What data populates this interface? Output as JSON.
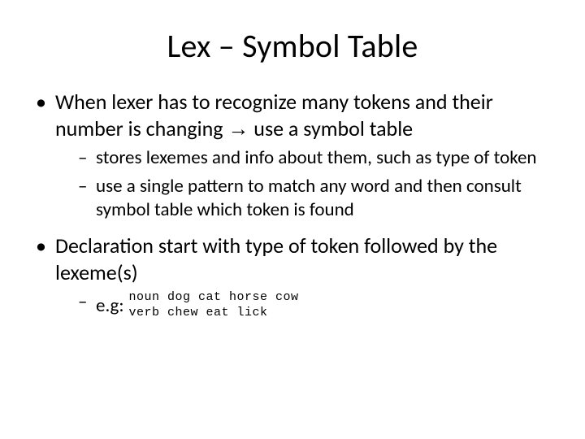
{
  "title": "Lex – Symbol Table",
  "bullets": [
    {
      "text_pre": "When lexer has to recognize many tokens and their number is changing ",
      "arrow": "→",
      "text_post": " use a symbol table",
      "sub": [
        {
          "text": "stores lexemes and info about them, such as type of token"
        },
        {
          "text": "use a single pattern to match any word and then consult symbol table which token is found"
        }
      ]
    },
    {
      "text": "Declaration start with type of token followed by the lexeme(s)",
      "sub": [
        {
          "label": "e.g:",
          "code": "noun dog cat horse cow\nverb chew eat lick"
        }
      ]
    }
  ]
}
